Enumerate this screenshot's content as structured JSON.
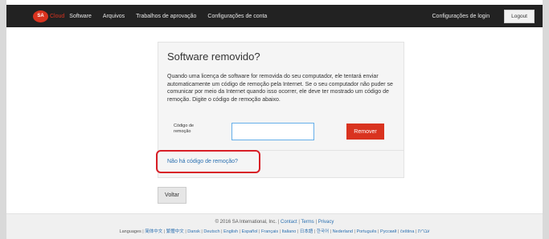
{
  "navbar": {
    "logo_text": "SA",
    "brand": "Cloud",
    "items": [
      "Software",
      "Arquivos",
      "Trabalhos de aprovação",
      "Configurações de conta"
    ],
    "login_settings": "Configurações de login",
    "logout": "Logout"
  },
  "panel": {
    "title": "Software removido?",
    "description": "Quando uma licença de software for removida do seu computador, ele tentará enviar automaticamente um código de remoção pela Internet. Se o seu computador não puder se comunicar por meio da Internet quando isso ocorrer, ele deve ter mostrado um código de remoção. Digite o código de remoção abaixo.",
    "code_label": "Código de remoção",
    "code_value": "",
    "remove_button": "Remover",
    "no_code_link": "Não há código de remoção?"
  },
  "back_button": "Voltar",
  "footer": {
    "copyright": "© 2016 SA International, Inc.",
    "links": [
      "Contact",
      "Terms",
      "Privacy"
    ],
    "languages_label": "Languages",
    "languages": [
      "简体中文",
      "繁體中文",
      "Dansk",
      "Deutsch",
      "English",
      "Español",
      "Français",
      "Italiano",
      "日本語",
      "한국어",
      "Nederland",
      "Português",
      "Русский",
      "čeština",
      "עברית"
    ]
  },
  "colors": {
    "navbar_bg": "#222222",
    "accent_red": "#d9331f",
    "link_blue": "#2a6fb0",
    "highlight_red": "#d81f27"
  }
}
